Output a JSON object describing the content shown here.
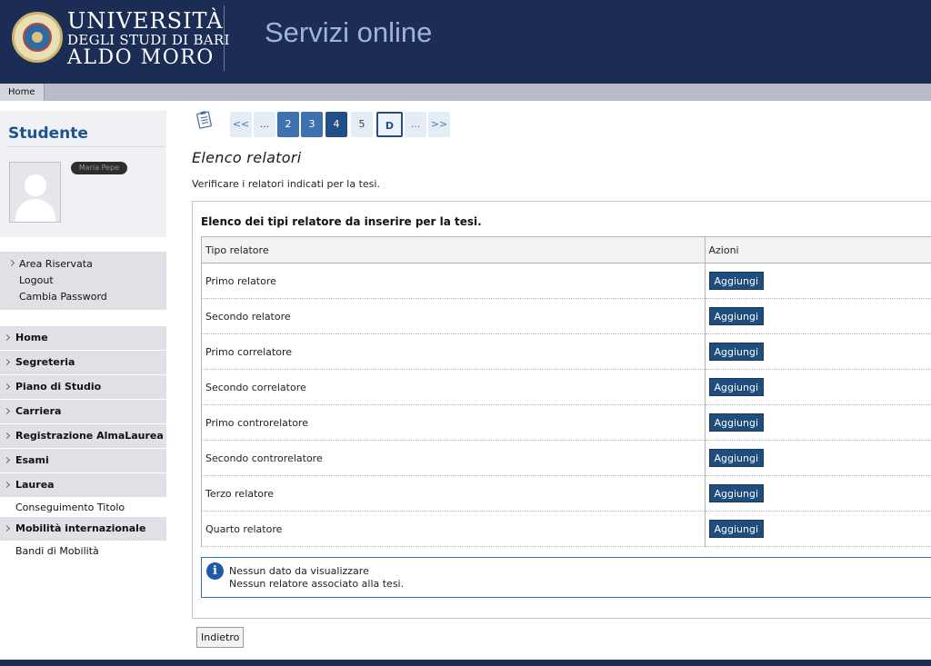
{
  "header": {
    "university_line1": "UNIVERSITÀ",
    "university_line2": "DEGLI STUDI DI BARI",
    "university_line3": "ALDO MORO",
    "service_title": "Servizi online"
  },
  "topnav": {
    "home_label": "Home"
  },
  "student": {
    "title": "Studente",
    "name_redacted": "Maria Pepe"
  },
  "account": {
    "items": [
      "Area Riservata",
      "Logout",
      "Cambia Password"
    ]
  },
  "menu": {
    "items": [
      {
        "label": "Home"
      },
      {
        "label": "Segreteria"
      },
      {
        "label": "Piano di Studio"
      },
      {
        "label": "Carriera"
      },
      {
        "label": "Registrazione AlmaLaurea"
      },
      {
        "label": "Esami"
      },
      {
        "label": "Laurea"
      }
    ],
    "laurea_sub": "Conseguimento Titolo",
    "mobility": "Mobilità internazionale",
    "mobility_sub": "Bandi di Mobilità"
  },
  "pager": {
    "first": "<<",
    "ellipsis_left": "...",
    "p2": "2",
    "p3": "3",
    "p4": "4",
    "p5": "5",
    "current": "D",
    "ellipsis_right": "...",
    "last": ">>"
  },
  "main": {
    "title": "Elenco relatori",
    "description": "Verificare i relatori indicati per la tesi.",
    "panel_title": "Elenco dei tipi relatore da inserire per la tesi."
  },
  "table": {
    "col_type": "Tipo relatore",
    "col_actions": "Azioni",
    "rows": [
      {
        "type": "Primo relatore",
        "action": "Aggiungi"
      },
      {
        "type": "Secondo relatore",
        "action": "Aggiungi"
      },
      {
        "type": "Primo correlatore",
        "action": "Aggiungi"
      },
      {
        "type": "Secondo correlatore",
        "action": "Aggiungi"
      },
      {
        "type": "Primo controrelatore",
        "action": "Aggiungi"
      },
      {
        "type": "Secondo controrelatore",
        "action": "Aggiungi"
      },
      {
        "type": "Terzo relatore",
        "action": "Aggiungi"
      },
      {
        "type": "Quarto relatore",
        "action": "Aggiungi"
      }
    ]
  },
  "info": {
    "icon": "info-icon",
    "line1": "Nessun dato da visualizzare",
    "line2": "Nessun relatore associato alla tesi."
  },
  "back_label": "Indietro",
  "colors": {
    "header_bg": "#1b2d55",
    "accent": "#1e5390",
    "button": "#1f4d7e"
  }
}
